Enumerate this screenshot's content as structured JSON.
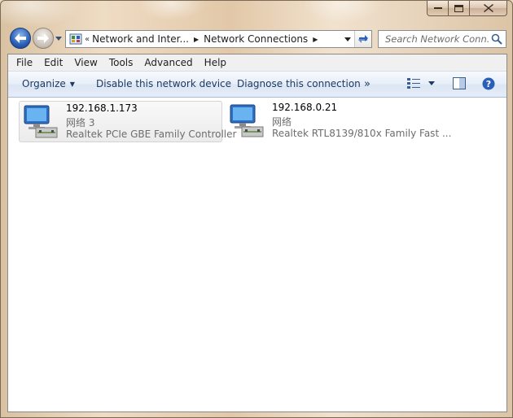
{
  "window": {
    "caption_buttons": {
      "minimize": "minimize-icon",
      "maximize": "maximize-icon",
      "close": "close-icon"
    }
  },
  "nav": {
    "breadcrumb": [
      "Network and Inter...",
      "Network Connections"
    ],
    "overflow_chevron": "«",
    "search_placeholder": "Search Network Conn..."
  },
  "menu": [
    "File",
    "Edit",
    "View",
    "Tools",
    "Advanced",
    "Help"
  ],
  "commands": {
    "organize": "Organize",
    "disable": "Disable this network device",
    "diagnose": "Diagnose this connection",
    "more": "»"
  },
  "connections": [
    {
      "name": "192.168.1.173",
      "network": "网络  3",
      "adapter": "Realtek PCIe GBE Family Controller",
      "selected": true
    },
    {
      "name": "192.168.0.21",
      "network": "网络",
      "adapter": "Realtek RTL8139/810x Family Fast ...",
      "selected": false
    }
  ],
  "colors": {
    "accent": "#2a5fb7",
    "selection": "#ebebeb",
    "command_text": "#1e3a61"
  }
}
